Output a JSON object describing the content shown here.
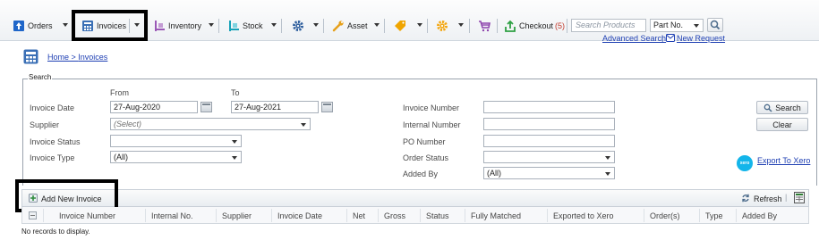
{
  "toolbar": {
    "orders": "Orders",
    "invoices": "Invoices",
    "inventory": "Inventory",
    "stock": "Stock",
    "asset": "Asset",
    "checkout": "Checkout",
    "checkout_count": "(5)",
    "search_placeholder": "Search Products",
    "search_field_option": "Part No.",
    "advanced_search": "Advanced Search",
    "new_request": "New Request"
  },
  "breadcrumb": {
    "home": "Home",
    "separator": " > ",
    "current": "Invoices"
  },
  "search_panel": {
    "legend": "Search",
    "from_label": "From",
    "to_label": "To",
    "invoice_date_label": "Invoice Date",
    "invoice_date_from": "27-Aug-2020",
    "invoice_date_to": "27-Aug-2021",
    "supplier_label": "Supplier",
    "supplier_value": "(Select)",
    "invoice_status_label": "Invoice Status",
    "invoice_status_value": "",
    "invoice_type_label": "Invoice Type",
    "invoice_type_value": "(All)",
    "invoice_number_label": "Invoice Number",
    "invoice_number_value": "",
    "internal_number_label": "Internal Number",
    "internal_number_value": "",
    "po_number_label": "PO Number",
    "po_number_value": "",
    "order_status_label": "Order Status",
    "order_status_value": "",
    "added_by_label": "Added By",
    "added_by_value": "(All)",
    "search_button": "Search",
    "clear_button": "Clear",
    "export_to_xero": "Export To Xero",
    "xero_logo_text": "xero"
  },
  "grid": {
    "add_new_invoice": "Add New Invoice",
    "refresh": "Refresh",
    "columns": [
      "Invoice Number",
      "Internal No.",
      "Supplier",
      "Invoice Date",
      "Net",
      "Gross",
      "Status",
      "Fully Matched",
      "Exported to Xero",
      "Order(s)",
      "Type",
      "Added By"
    ],
    "empty_message": "No records to display."
  },
  "colors": {
    "link": "#1e3fb3",
    "orders_icon": "#1f66c9",
    "checkout_icon": "#2ea043",
    "checkout_count": "#c0392b",
    "gear_icon": "#f3a712",
    "highlight_box": "#000000"
  }
}
